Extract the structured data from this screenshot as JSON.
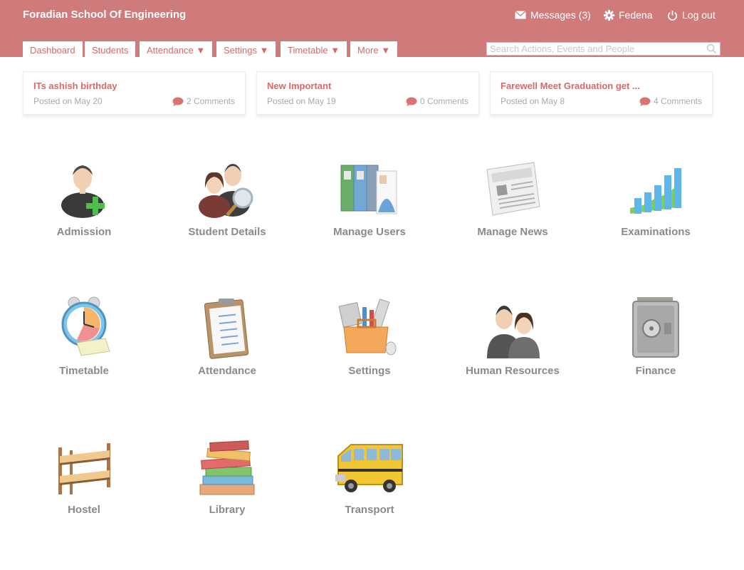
{
  "header": {
    "school_name": "Foradian School Of Engineering",
    "messages": "Messages (3)",
    "user": "Fedena",
    "logout": "Log out"
  },
  "tabs": [
    "Dashboard",
    "Students",
    "Attendance ▼",
    "Settings ▼",
    "Timetable ▼",
    "More ▼"
  ],
  "search": {
    "placeholder": "Search Actions, Events and People"
  },
  "news": [
    {
      "title": "ITs ashish birthday",
      "posted": "Posted on May 20",
      "comments": "2 Comments"
    },
    {
      "title": "New Important",
      "posted": "Posted on May 19",
      "comments": "0 Comments"
    },
    {
      "title": "Farewell Meet Graduation get ...",
      "posted": "Posted on May 8",
      "comments": "4 Comments"
    }
  ],
  "modules": [
    {
      "label": "Admission",
      "icon": "admission-icon"
    },
    {
      "label": "Student Details",
      "icon": "student-details-icon"
    },
    {
      "label": "Manage Users",
      "icon": "manage-users-icon"
    },
    {
      "label": "Manage News",
      "icon": "newspaper-icon"
    },
    {
      "label": "Examinations",
      "icon": "bar-chart-icon"
    },
    {
      "label": "Timetable",
      "icon": "alarm-clock-icon"
    },
    {
      "label": "Attendance",
      "icon": "clipboard-icon"
    },
    {
      "label": "Settings",
      "icon": "toolbox-icon"
    },
    {
      "label": "Human Resources",
      "icon": "people-icon"
    },
    {
      "label": "Finance",
      "icon": "safe-icon"
    },
    {
      "label": "Hostel",
      "icon": "bunk-bed-icon"
    },
    {
      "label": "Library",
      "icon": "books-icon"
    },
    {
      "label": "Transport",
      "icon": "school-bus-icon"
    }
  ],
  "colors": {
    "header": "#cf7b7b",
    "accent": "#d46a6a",
    "label": "#8a8a8a"
  }
}
